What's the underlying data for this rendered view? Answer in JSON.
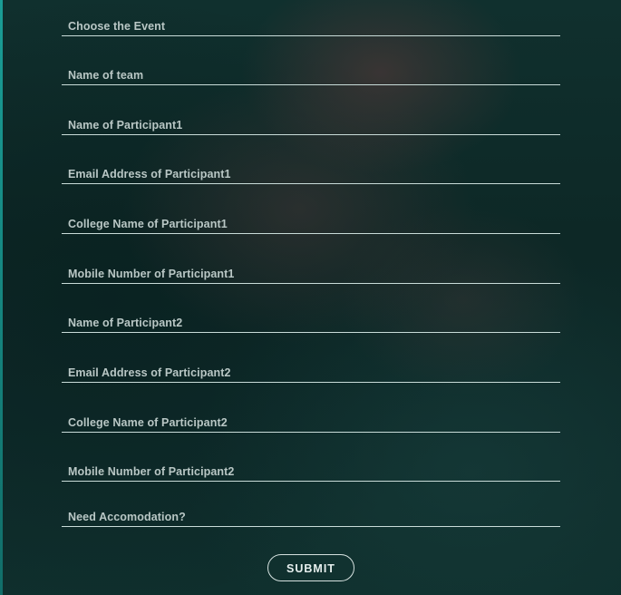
{
  "form": {
    "fields": [
      {
        "label": "Choose the Event"
      },
      {
        "label": "Name of team"
      },
      {
        "label": "Name of Participant1"
      },
      {
        "label": "Email Address of Participant1"
      },
      {
        "label": "College Name of Participant1"
      },
      {
        "label": "Mobile Number of Participant1"
      },
      {
        "label": "Name of Participant2"
      },
      {
        "label": "Email Address of Participant2"
      },
      {
        "label": "College Name of Participant2"
      },
      {
        "label": "Mobile Number of Participant2"
      },
      {
        "label": "Need Accomodation?"
      }
    ],
    "submit_label": "SUBMIT"
  },
  "colors": {
    "background": "#0e2b2a",
    "underline": "#c9dcd9",
    "label_text": "#b9c7c5",
    "accent_edge": "#1a9d96"
  }
}
